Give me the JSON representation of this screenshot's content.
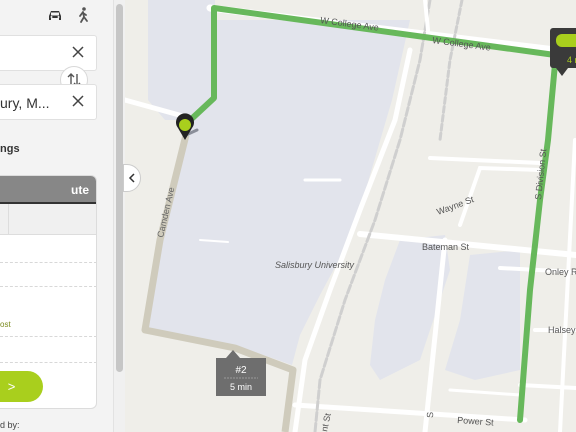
{
  "panel": {
    "modes": [
      {
        "name": "car-icon",
        "active": false
      },
      {
        "name": "walk-icon",
        "active": false
      }
    ],
    "origin_value": "",
    "destination_value": "ury, M...",
    "settings_label": "ngs",
    "route_header": "ute",
    "cost_text": "ost",
    "go_button_label": ">",
    "footer_text": "d by:"
  },
  "map": {
    "streets": {
      "w_college_ave": "W College Ave",
      "camden_ave": "Camden Ave",
      "s_division_st": "S Division St",
      "wayne_st": "Wayne St",
      "bateman_st": "Bateman St",
      "onley_rd": "Onley R",
      "halsey": "Halsey",
      "power_st": "Power St",
      "vertical_st_1": "nt St",
      "vertical_st_2": "S"
    },
    "campus_label": "Salisbury University",
    "route_badge": {
      "number": "#2",
      "time": "5 min"
    },
    "corner_badge": {
      "text": "4 n"
    },
    "colors": {
      "active_route": "#67b85b",
      "alt_route": "#cfcbbc",
      "campus": "#e2e4ec",
      "road": "#ffffff",
      "background": "#efeee9",
      "accent": "#a9cf1d"
    }
  }
}
